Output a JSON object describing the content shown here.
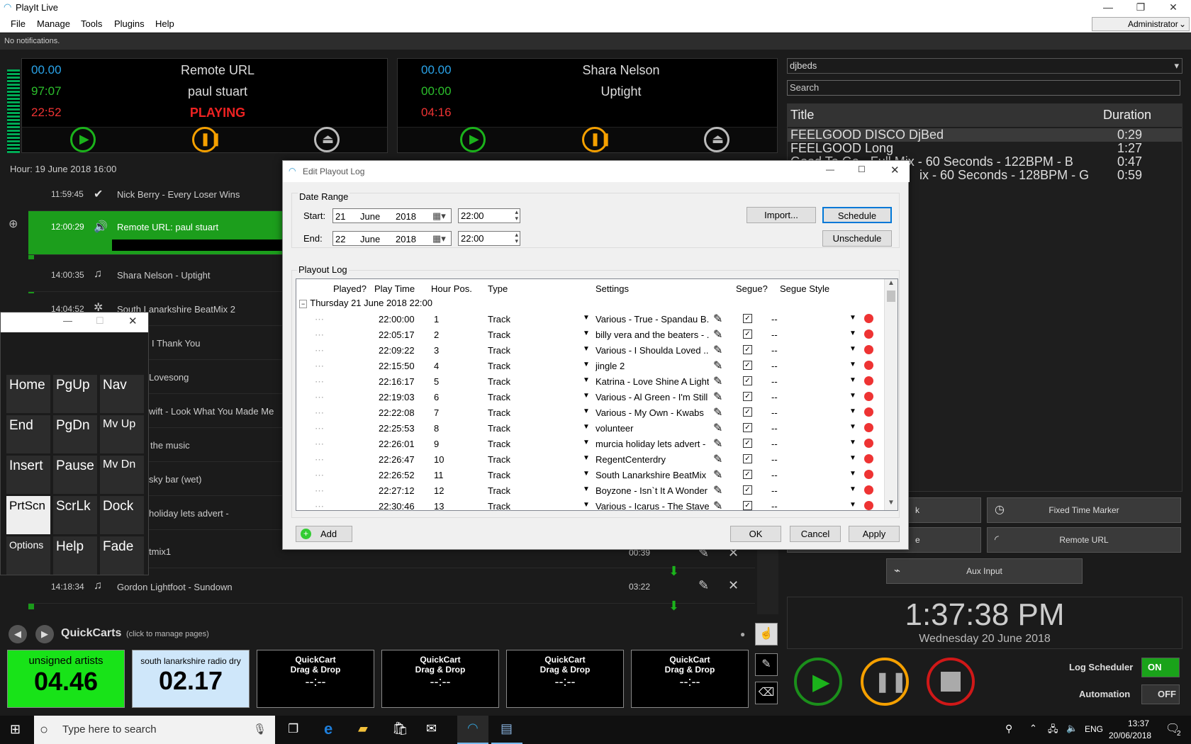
{
  "app": {
    "title": "PlayIt Live",
    "notifications": "No notifications.",
    "user": "Administrator"
  },
  "menu": [
    "File",
    "Manage",
    "Tools",
    "Plugins",
    "Help"
  ],
  "player1": {
    "t1": "00.00",
    "t2": "97:07",
    "t3": "22:52",
    "line1": "Remote URL",
    "line2": "paul stuart",
    "status": "PLAYING"
  },
  "player2": {
    "t1": "00.00",
    "t2": "00:00",
    "t3": "04:16",
    "line1": "Shara Nelson",
    "line2": "Uptight"
  },
  "log": {
    "hour": "Hour: 19 June 2018 16:00",
    "rows": [
      {
        "time": "11:59:45",
        "title": "Nick Berry - Every Loser Wins"
      },
      {
        "time": "12:00:29",
        "title": "Remote URL: paul stuart"
      },
      {
        "time": "14:00:35",
        "title": "Shara Nelson - Uptight"
      },
      {
        "time": "14:04:52",
        "title": "South Lanarkshire BeatMix 2"
      },
      {
        "time": "",
        "title": "I Thank You"
      },
      {
        "time": "",
        "title": "Lovesong"
      },
      {
        "time": "",
        "title": "wift - Look What You Made Me"
      },
      {
        "time": "",
        "title": "the music"
      },
      {
        "time": "",
        "title": "sky bar (wet)"
      },
      {
        "time": "",
        "title": "holiday lets advert -"
      },
      {
        "time": "",
        "title": "tmix1"
      },
      {
        "time": "14:18:34",
        "title": "Gordon Lightfoot - Sundown"
      }
    ],
    "durations": [
      "00:39",
      "03:22"
    ]
  },
  "library": {
    "category": "djbeds",
    "search_placeholder": "Search",
    "col_title": "Title",
    "col_duration": "Duration",
    "rows": [
      {
        "title": "FEELGOOD DISCO DjBed",
        "duration": "0:29"
      },
      {
        "title": "FEELGOOD Long",
        "duration": "1:27"
      },
      {
        "title": "Good To Go - Full Mix - 60 Seconds - 122BPM - B",
        "duration": "0:47"
      },
      {
        "title": "ix - 60 Seconds - 128BPM - G",
        "duration": "0:59"
      }
    ]
  },
  "rightbuttons": {
    "fixed": "Fixed Time Marker",
    "remote": "Remote URL",
    "aux": "Aux Input",
    "k": "k",
    "e": "e"
  },
  "clock": {
    "time": "1:37:38 PM",
    "date": "Wednesday 20 June 2018"
  },
  "automation": {
    "scheduler_label": "Log Scheduler",
    "scheduler_state": "ON",
    "automation_label": "Automation",
    "automation_state": "OFF"
  },
  "quickcarts": {
    "title": "QuickCarts",
    "hint": "(click to manage pages)",
    "carts": [
      {
        "name": "unsigned artists",
        "time": "04.46"
      },
      {
        "name": "south lanarkshire radio dry",
        "time": "02.17"
      },
      {
        "name": "QuickCart\nDrag & Drop",
        "time": "--:--"
      },
      {
        "name": "QuickCart\nDrag & Drop",
        "time": "--:--"
      },
      {
        "name": "QuickCart\nDrag & Drop",
        "time": "--:--"
      },
      {
        "name": "QuickCart\nDrag & Drop",
        "time": "--:--"
      }
    ]
  },
  "keypad": [
    "Home",
    "PgUp",
    "Nav",
    "End",
    "PgDn",
    "Mv Up",
    "Insert",
    "Pause",
    "Mv Dn",
    "PrtScn",
    "ScrLk",
    "Dock",
    "Options",
    "Help",
    "Fade"
  ],
  "dialog": {
    "title": "Edit Playout Log",
    "date_range": "Date Range",
    "start_label": "Start:",
    "end_label": "End:",
    "start": {
      "day": "21",
      "month": "June",
      "year": "2018",
      "time": "22:00"
    },
    "end": {
      "day": "22",
      "month": "June",
      "year": "2018",
      "time": "22:00"
    },
    "import": "Import...",
    "schedule": "Schedule",
    "unschedule": "Unschedule",
    "playout_log": "Playout Log",
    "columns": [
      "Played?",
      "Play Time",
      "Hour Pos.",
      "Type",
      "Settings",
      "Segue?",
      "Segue Style"
    ],
    "group": "Thursday 21 June 2018 22:00",
    "rows": [
      {
        "time": "22:00:00",
        "pos": "1",
        "type": "Track",
        "settings": "Various - True - Spandau B...",
        "style": "--"
      },
      {
        "time": "22:05:17",
        "pos": "2",
        "type": "Track",
        "settings": "billy vera and the beaters - ...",
        "style": "--"
      },
      {
        "time": "22:09:22",
        "pos": "3",
        "type": "Track",
        "settings": "Various - I Shoulda Loved ...",
        "style": "--"
      },
      {
        "time": "22:15:50",
        "pos": "4",
        "type": "Track",
        "settings": "jingle 2",
        "style": "--"
      },
      {
        "time": "22:16:17",
        "pos": "5",
        "type": "Track",
        "settings": "Katrina - Love Shine A Light",
        "style": "--"
      },
      {
        "time": "22:19:03",
        "pos": "6",
        "type": "Track",
        "settings": "Various - Al Green - I'm Still ...",
        "style": "--"
      },
      {
        "time": "22:22:08",
        "pos": "7",
        "type": "Track",
        "settings": "Various - My Own - Kwabs",
        "style": "--"
      },
      {
        "time": "22:25:53",
        "pos": "8",
        "type": "Track",
        "settings": "volunteer",
        "style": "--"
      },
      {
        "time": "22:26:01",
        "pos": "9",
        "type": "Track",
        "settings": "murcia holiday lets advert -",
        "style": "--"
      },
      {
        "time": "22:26:47",
        "pos": "10",
        "type": "Track",
        "settings": "RegentCenterdry",
        "style": "--"
      },
      {
        "time": "22:26:52",
        "pos": "11",
        "type": "Track",
        "settings": "South Lanarkshire BeatMix 2",
        "style": "--"
      },
      {
        "time": "22:27:12",
        "pos": "12",
        "type": "Track",
        "settings": "Boyzone - Isn`t It A Wonder",
        "style": "--"
      },
      {
        "time": "22:30:46",
        "pos": "13",
        "type": "Track",
        "settings": "Various - Icarus - The Staves",
        "style": "--"
      }
    ],
    "add": "Add",
    "ok": "OK",
    "cancel": "Cancel",
    "apply": "Apply"
  },
  "taskbar": {
    "search": "Type here to search",
    "lang": "ENG",
    "time": "13:37",
    "date": "20/06/2018",
    "notif": "2"
  }
}
